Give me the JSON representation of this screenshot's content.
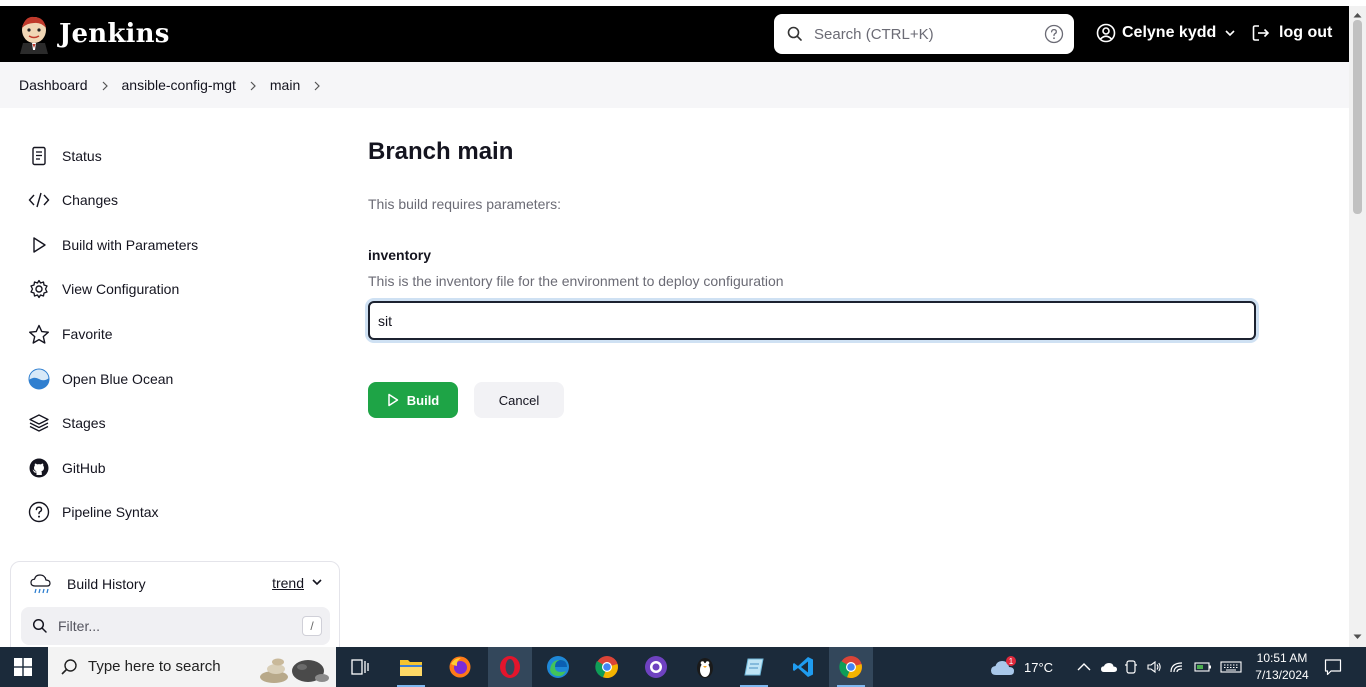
{
  "header": {
    "brand": "Jenkins",
    "search_placeholder": "Search (CTRL+K)",
    "user_name": "Celyne kydd",
    "logout_label": "log out"
  },
  "breadcrumbs": [
    "Dashboard",
    "ansible-config-mgt",
    "main"
  ],
  "sidebar": {
    "items": [
      {
        "label": "Status",
        "icon": "document-icon"
      },
      {
        "label": "Changes",
        "icon": "code-icon"
      },
      {
        "label": "Build with Parameters",
        "icon": "play-icon"
      },
      {
        "label": "View Configuration",
        "icon": "gear-icon"
      },
      {
        "label": "Favorite",
        "icon": "star-icon"
      },
      {
        "label": "Open Blue Ocean",
        "icon": "blue-ocean-icon"
      },
      {
        "label": "Stages",
        "icon": "layers-icon"
      },
      {
        "label": "GitHub",
        "icon": "github-icon"
      },
      {
        "label": "Pipeline Syntax",
        "icon": "help-icon"
      }
    ]
  },
  "build_history": {
    "title": "Build History",
    "trend_label": "trend",
    "filter_placeholder": "Filter...",
    "filter_shortcut": "/"
  },
  "main": {
    "title": "Branch main",
    "requires_text": "This build requires parameters:",
    "param_name": "inventory",
    "param_description": "This is the inventory file for the environment to deploy configuration",
    "param_value": "sit",
    "build_label": "Build",
    "cancel_label": "Cancel"
  },
  "taskbar": {
    "search_placeholder": "Type here to search",
    "weather_temp": "17°C",
    "weather_badge": "1",
    "time": "10:51 AM",
    "date": "7/13/2024"
  },
  "colors": {
    "header_bg": "#000000",
    "build_green": "#1ea446",
    "taskbar_bg": "#1b2a3a"
  }
}
